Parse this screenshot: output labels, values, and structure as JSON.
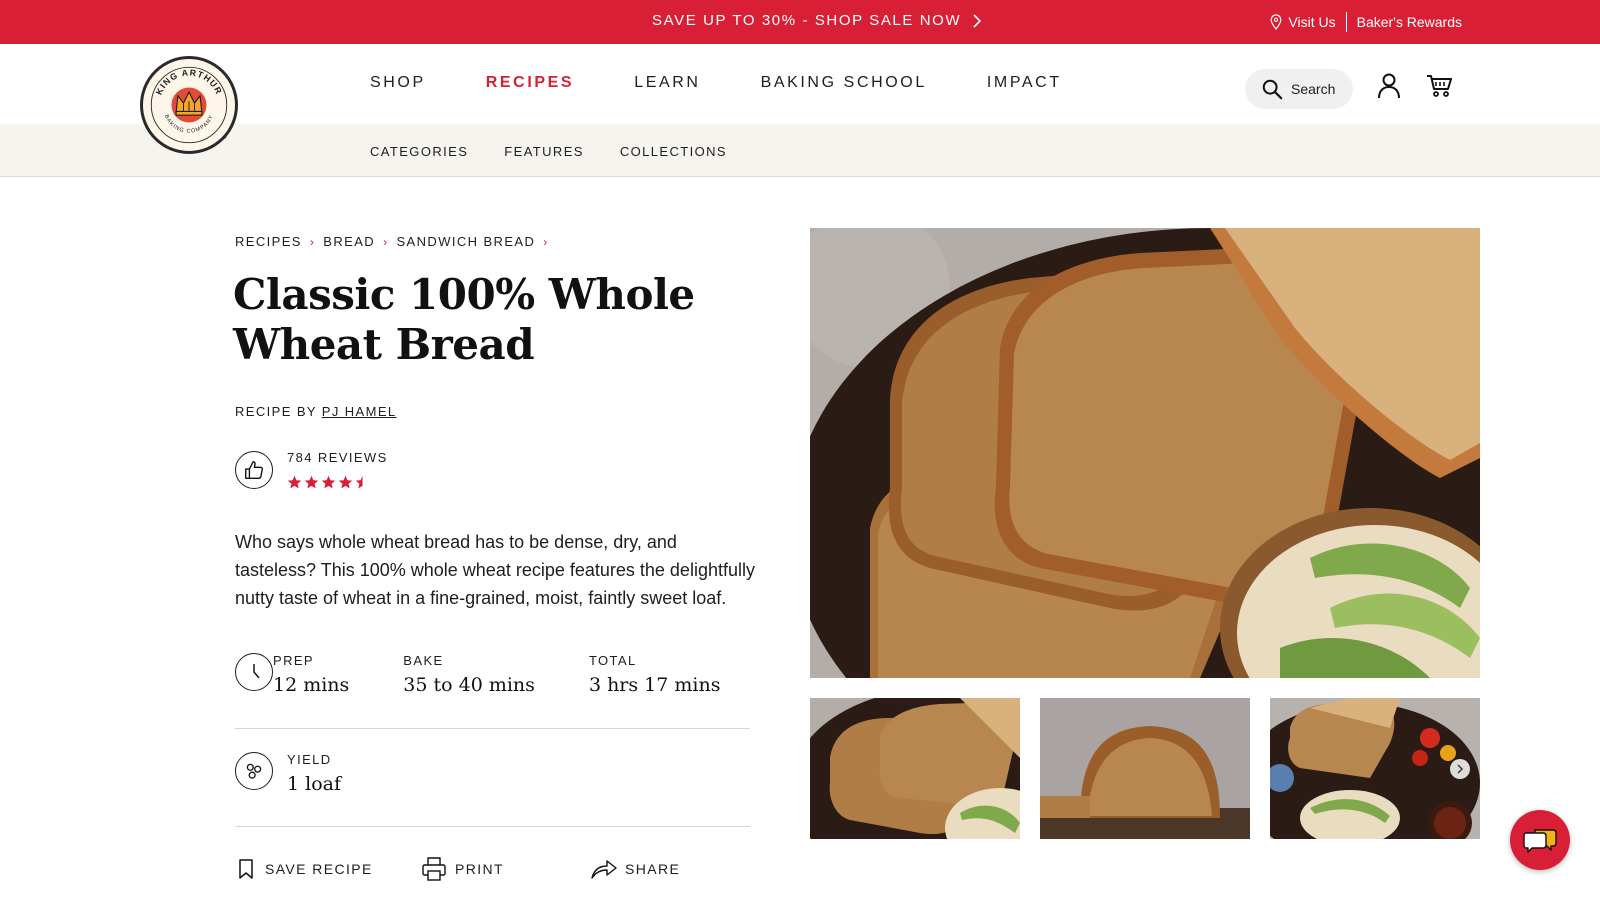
{
  "colors": {
    "brand_red": "#d91f36",
    "subnav_bg": "#f6f4ef",
    "text": "#1e1e1e"
  },
  "promo": {
    "text": "SAVE UP TO 30% - SHOP SALE NOW",
    "icon": "chevron-right-icon"
  },
  "utility": {
    "visit": "Visit Us",
    "rewards": "Baker's Rewards"
  },
  "logo": {
    "top_text": "KING ARTHUR",
    "bottom_text": "BAKING COMPANY",
    "tm": "™"
  },
  "nav": {
    "items": [
      {
        "label": "SHOP",
        "active": false
      },
      {
        "label": "RECIPES",
        "active": true
      },
      {
        "label": "LEARN",
        "active": false
      },
      {
        "label": "BAKING SCHOOL",
        "active": false
      },
      {
        "label": "IMPACT",
        "active": false
      }
    ],
    "search": "Search"
  },
  "subnav": {
    "items": [
      "CATEGORIES",
      "FEATURES",
      "COLLECTIONS"
    ]
  },
  "breadcrumb": [
    "RECIPES",
    "BREAD",
    "SANDWICH BREAD"
  ],
  "recipe": {
    "title": "Classic 100% Whole Wheat Bread",
    "by_prefix": "RECIPE BY",
    "author": "PJ HAMEL",
    "reviews": "784 REVIEWS",
    "rating": 4.5,
    "rating_max": 5,
    "description": "Who says whole wheat bread has to be dense, dry, and tasteless? This 100% whole wheat recipe features the delightfully nutty taste of wheat in a fine-grained, moist, faintly sweet loaf.",
    "times": [
      {
        "label": "PREP",
        "value": "12 mins"
      },
      {
        "label": "BAKE",
        "value": "35 to 40 mins"
      },
      {
        "label": "TOTAL",
        "value": "3 hrs 17 mins"
      }
    ],
    "yield": {
      "label": "YIELD",
      "value": "1 loaf"
    }
  },
  "actions": {
    "save": "SAVE RECIPE",
    "print": "PRINT",
    "share": "SHARE"
  }
}
